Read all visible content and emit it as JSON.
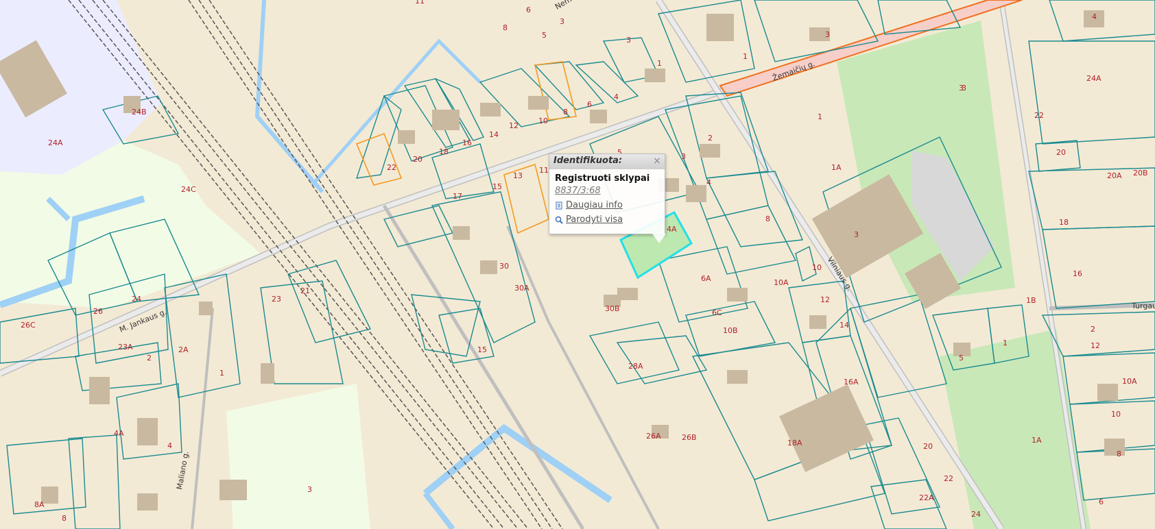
{
  "map": {
    "parcel_color": "#1a8a90",
    "highlight_color": "#22e0e8",
    "selected_fill": "#bde8b0",
    "orange_parcel": "#f39a21",
    "water": "#9fd0f5",
    "streets": {
      "zemaiciu": "Žemaičių g.",
      "vilniaus": "Vilniaus g.",
      "jankaus": "M. Jankaus g.",
      "maliano": "Maliano g.",
      "turgaus": "Turgau",
      "nemuno": "Nem"
    },
    "labels": [
      {
        "t": "11"
      },
      {
        "t": "6"
      },
      {
        "t": "8"
      },
      {
        "t": "5"
      },
      {
        "t": "3"
      },
      {
        "t": "3"
      },
      {
        "t": "1"
      },
      {
        "t": "24B"
      },
      {
        "t": "24A"
      },
      {
        "t": "24C"
      },
      {
        "t": "22"
      },
      {
        "t": "20"
      },
      {
        "t": "18"
      },
      {
        "t": "16"
      },
      {
        "t": "14"
      },
      {
        "t": "12"
      },
      {
        "t": "10"
      },
      {
        "t": "8"
      },
      {
        "t": "6"
      },
      {
        "t": "4"
      },
      {
        "t": "1"
      },
      {
        "t": "3"
      },
      {
        "t": "4"
      },
      {
        "t": "3"
      },
      {
        "t": "24A"
      },
      {
        "t": "22"
      },
      {
        "t": "20"
      },
      {
        "t": "20A"
      },
      {
        "t": "20B"
      },
      {
        "t": "18"
      },
      {
        "t": "16"
      },
      {
        "t": "1B"
      },
      {
        "t": "1"
      },
      {
        "t": "2"
      },
      {
        "t": "12"
      },
      {
        "t": "10A"
      },
      {
        "t": "10"
      },
      {
        "t": "8"
      },
      {
        "t": "6"
      },
      {
        "t": "1A"
      },
      {
        "t": "1"
      },
      {
        "t": "1A"
      },
      {
        "t": "3"
      },
      {
        "t": "3"
      },
      {
        "t": "2"
      },
      {
        "t": "3"
      },
      {
        "t": "4"
      },
      {
        "t": "8"
      },
      {
        "t": "4A"
      },
      {
        "t": "6A"
      },
      {
        "t": "10A"
      },
      {
        "t": "10"
      },
      {
        "t": "12"
      },
      {
        "t": "14"
      },
      {
        "t": "6C"
      },
      {
        "t": "10B"
      },
      {
        "t": "16A"
      },
      {
        "t": "18A"
      },
      {
        "t": "20"
      },
      {
        "t": "22"
      },
      {
        "t": "22A"
      },
      {
        "t": "24"
      },
      {
        "t": "5"
      },
      {
        "t": "13"
      },
      {
        "t": "11"
      },
      {
        "t": "15"
      },
      {
        "t": "17"
      },
      {
        "t": "30"
      },
      {
        "t": "30A"
      },
      {
        "t": "30B"
      },
      {
        "t": "15"
      },
      {
        "t": "28A"
      },
      {
        "t": "26A"
      },
      {
        "t": "26B"
      },
      {
        "t": "23"
      },
      {
        "t": "21"
      },
      {
        "t": "23A"
      },
      {
        "t": "2"
      },
      {
        "t": "2A"
      },
      {
        "t": "1"
      },
      {
        "t": "24"
      },
      {
        "t": "26"
      },
      {
        "t": "26C"
      },
      {
        "t": "4A"
      },
      {
        "t": "4"
      },
      {
        "t": "8A"
      },
      {
        "t": "8"
      },
      {
        "t": "3"
      },
      {
        "t": "5"
      }
    ]
  },
  "popup": {
    "title": "Identifikuota:",
    "heading": "Registruoti sklypai",
    "parcel_id": "8837/3:68",
    "more_info": "Daugiau info",
    "show_all": "Parodyti visa"
  }
}
